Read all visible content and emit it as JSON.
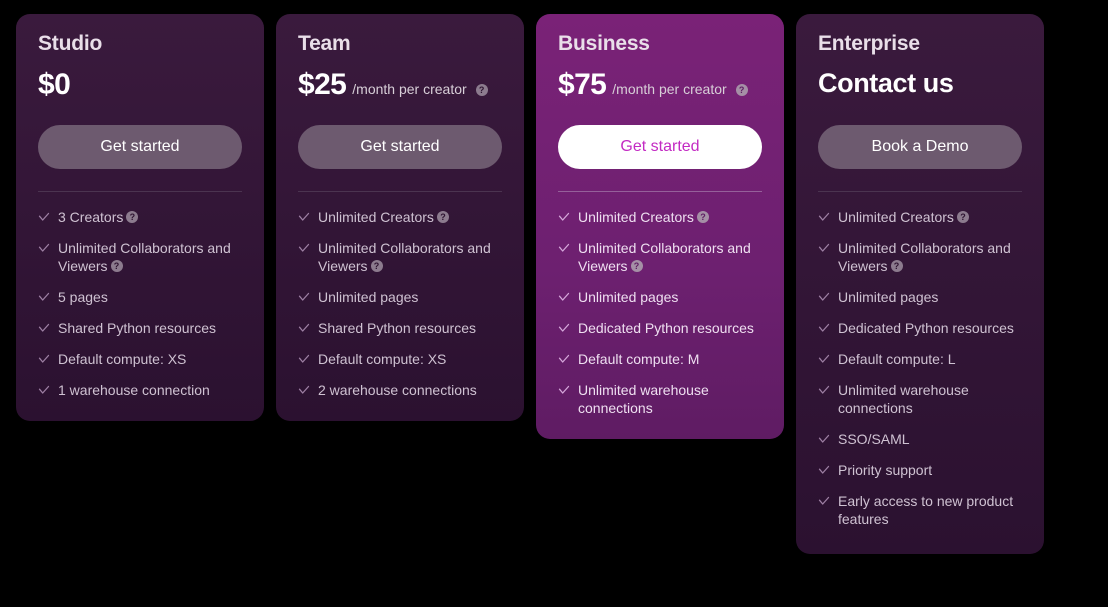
{
  "theme": {
    "page_background": "#000000",
    "card_background": "#2d1330",
    "featured_card_background": "#6d2070",
    "button_background": "#6d5a6f",
    "primary_button_background": "#ffffff",
    "primary_button_text_color": "#c32ac3",
    "heading_color": "#e9dfe9",
    "feature_text_color": "#cfc2d2"
  },
  "icons": {
    "info": "?",
    "check": "check-icon"
  },
  "plans": [
    {
      "name": "Studio",
      "price": "$0",
      "price_unit": "",
      "price_has_info": false,
      "cta_label": "Get started",
      "featured": false,
      "features": [
        {
          "text": "3 Creators",
          "info": true
        },
        {
          "text": "Unlimited Collaborators and Viewers",
          "info": true
        },
        {
          "text": "5 pages",
          "info": false
        },
        {
          "text": "Shared Python resources",
          "info": false
        },
        {
          "text": "Default compute: XS",
          "info": false
        },
        {
          "text": "1 warehouse connection",
          "info": false
        }
      ]
    },
    {
      "name": "Team",
      "price": "$25",
      "price_unit": "/month per creator",
      "price_has_info": true,
      "cta_label": "Get started",
      "featured": false,
      "features": [
        {
          "text": "Unlimited Creators",
          "info": true
        },
        {
          "text": "Unlimited Collaborators and Viewers",
          "info": true
        },
        {
          "text": "Unlimited pages",
          "info": false
        },
        {
          "text": "Shared Python resources",
          "info": false
        },
        {
          "text": "Default compute: XS",
          "info": false
        },
        {
          "text": "2 warehouse connections",
          "info": false
        }
      ]
    },
    {
      "name": "Business",
      "price": "$75",
      "price_unit": "/month per creator",
      "price_has_info": true,
      "cta_label": "Get started",
      "featured": true,
      "features": [
        {
          "text": "Unlimited Creators",
          "info": true
        },
        {
          "text": "Unlimited Collaborators and Viewers",
          "info": true
        },
        {
          "text": "Unlimited pages",
          "info": false
        },
        {
          "text": "Dedicated Python resources",
          "info": false
        },
        {
          "text": "Default compute: M",
          "info": false
        },
        {
          "text": "Unlimited warehouse connections",
          "info": false
        }
      ]
    },
    {
      "name": "Enterprise",
      "price": "Contact us",
      "price_unit": "",
      "price_has_info": false,
      "cta_label": "Book a Demo",
      "featured": false,
      "features": [
        {
          "text": "Unlimited Creators",
          "info": true
        },
        {
          "text": "Unlimited Collaborators and Viewers",
          "info": true
        },
        {
          "text": "Unlimited pages",
          "info": false
        },
        {
          "text": "Dedicated Python resources",
          "info": false
        },
        {
          "text": "Default compute: L",
          "info": false
        },
        {
          "text": "Unlimited warehouse connections",
          "info": false
        },
        {
          "text": "SSO/SAML",
          "info": false
        },
        {
          "text": "Priority support",
          "info": false
        },
        {
          "text": "Early access to new product features",
          "info": false
        }
      ]
    }
  ]
}
